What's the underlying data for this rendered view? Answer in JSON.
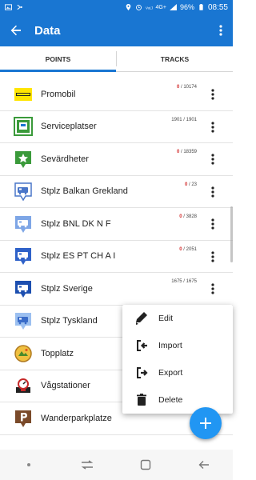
{
  "status_bar": {
    "time": "08:55",
    "battery": "96%",
    "network": "4G+"
  },
  "app_bar": {
    "title": "Data"
  },
  "tabs": [
    {
      "label": "POINTS",
      "active": true
    },
    {
      "label": "TRACKS",
      "active": false
    }
  ],
  "points": [
    {
      "name": "Promobil",
      "count_current": "0",
      "count_total": "10174",
      "icon": "promobil-logo-icon"
    },
    {
      "name": "Serviceplatser",
      "count_current": "1901",
      "count_total": "1901",
      "icon": "service-place-icon"
    },
    {
      "name": "Sevärdheter",
      "count_current": "0",
      "count_total": "18359",
      "icon": "star-pin-icon"
    },
    {
      "name": "Stplz Balkan Grekland",
      "count_current": "0",
      "count_total": "23",
      "icon": "camper-pin-icon"
    },
    {
      "name": "Stplz BNL DK N F",
      "count_current": "0",
      "count_total": "3828",
      "icon": "camper-pin-icon"
    },
    {
      "name": "Stplz ES PT CH A I",
      "count_current": "0",
      "count_total": "2051",
      "icon": "camper-pin-icon"
    },
    {
      "name": "Stplz Sverige",
      "count_current": "1675",
      "count_total": "1675",
      "icon": "camper-pin-icon"
    },
    {
      "name": "Stplz Tyskland",
      "count_current": "",
      "count_total": "",
      "icon": "camper-pin-icon"
    },
    {
      "name": "Topplatz",
      "count_current": "",
      "count_total": "",
      "icon": "topplatz-badge-icon"
    },
    {
      "name": "Vågstationer",
      "count_current": "",
      "count_total": "",
      "icon": "scale-icon"
    },
    {
      "name": "Wanderparkplatze",
      "count_current": "",
      "count_total": "",
      "icon": "parking-pin-icon"
    }
  ],
  "popup_menu": [
    {
      "label": "Edit",
      "icon": "edit-icon"
    },
    {
      "label": "Import",
      "icon": "import-icon"
    },
    {
      "label": "Export",
      "icon": "export-icon"
    },
    {
      "label": "Delete",
      "icon": "delete-icon"
    }
  ],
  "colors": {
    "primary": "#1976d2",
    "fab": "#2196f3",
    "count_zero": "#d32f2f"
  }
}
